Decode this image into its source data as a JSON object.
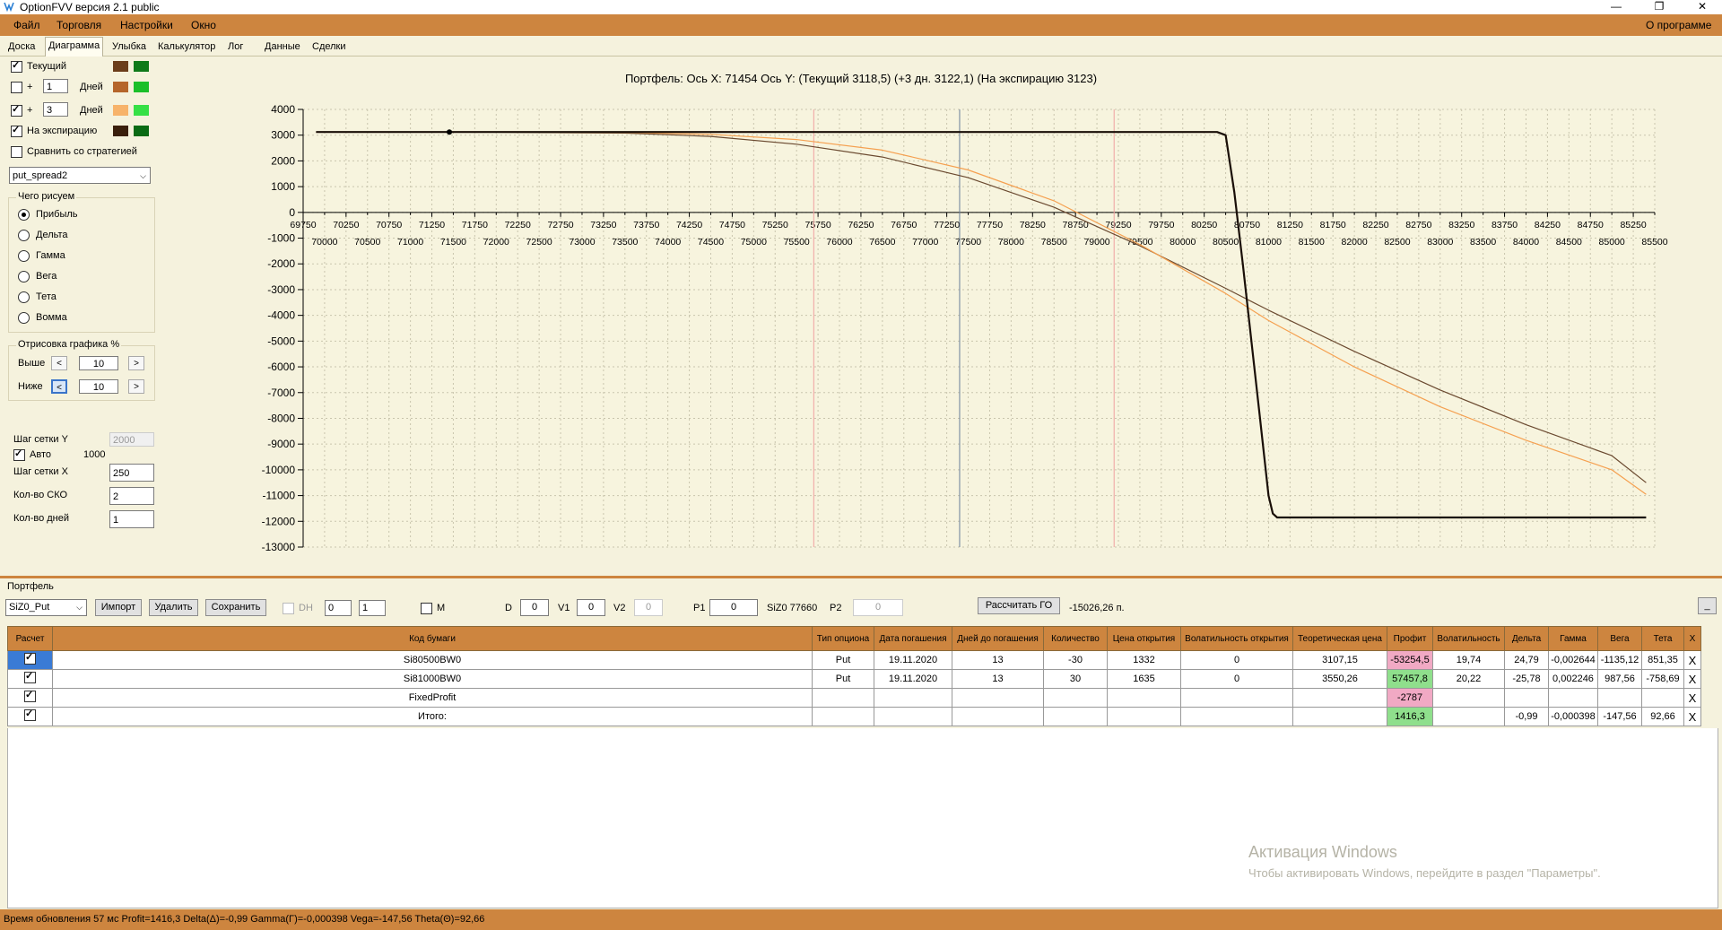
{
  "window": {
    "title": "OptionFVV версия 2.1 public",
    "min": "—",
    "max": "❐",
    "close": "✕"
  },
  "menu": {
    "items": [
      "Файл",
      "Торговля",
      "Настройки",
      "Окно"
    ],
    "about": "О программе"
  },
  "tabs": [
    "Доска",
    "Диаграмма",
    "Улыбка",
    "Калькулятор",
    "Лог",
    "Данные",
    "Сделки"
  ],
  "left": {
    "current": "Текущий",
    "plus": "+",
    "days": "Дней",
    "days1_value": "1",
    "days2_value": "3",
    "expiry": "На экспирацию",
    "compare": "Сравнить со стратегией",
    "strategy": "put_spread2",
    "what_title": "Чего рисуем",
    "radios": [
      "Прибыль",
      "Дельта",
      "Гамма",
      "Вега",
      "Тета",
      "Вомма"
    ],
    "draw_title": "Отрисовка графика %",
    "above": "Выше",
    "below": "Ниже",
    "above_value": "10",
    "below_value": "10",
    "left_arrow": "<",
    "right_arrow": ">",
    "grid_y": "Шаг сетки Y",
    "grid_y_value": "2000",
    "auto": "Авто",
    "auto_value": "1000",
    "grid_x": "Шаг сетки X",
    "grid_x_value": "250",
    "sko": "Кол-во СКО",
    "sko_value": "2",
    "ndays": "Кол-во дней",
    "ndays_value": "1",
    "colors": {
      "cur_dark": "#6b3d1a",
      "cur_green": "#0f7a1a",
      "d1_brown": "#b5652a",
      "d1_green": "#1bbf2a",
      "d3_orange": "#f7b36a",
      "d3_green": "#36e046",
      "exp_dark": "#3a1f0c",
      "exp_green": "#0a6b14"
    }
  },
  "chart_header": "Портфель: Ось X: 71454 Ось Y:  (Текущий 3118,5)  (+3 дн. 3122,1)  (На экспирацию 3123)",
  "chart_data": {
    "type": "line",
    "xlim": [
      69750,
      85500
    ],
    "ylim": [
      -13000,
      4000
    ],
    "y_ticks": [
      4000,
      3000,
      2000,
      1000,
      0,
      -1000,
      -2000,
      -3000,
      -4000,
      -5000,
      -6000,
      -7000,
      -8000,
      -9000,
      -10000,
      -11000,
      -12000,
      -13000
    ],
    "x_ticks_upper": [
      69750,
      70250,
      70750,
      71250,
      71750,
      72250,
      72750,
      73250,
      73750,
      74250,
      74750,
      75250,
      75750,
      76250,
      76750,
      77250,
      77750,
      78250,
      78750,
      79250,
      79750,
      80250,
      80750,
      81250,
      81750,
      82250,
      82750,
      83250,
      83750,
      84250,
      84750,
      85250
    ],
    "x_ticks_lower": [
      70000,
      70500,
      71000,
      71500,
      72000,
      72500,
      73000,
      73500,
      74000,
      74500,
      75000,
      75500,
      76000,
      76500,
      77000,
      77500,
      78000,
      78500,
      79000,
      79500,
      80000,
      80500,
      81000,
      81500,
      82000,
      82500,
      83000,
      83500,
      84000,
      84500,
      85000,
      85500
    ],
    "vlines": [
      {
        "x": 75700,
        "color": "#f0a0a0"
      },
      {
        "x": 77400,
        "color": "#6a7f9a"
      },
      {
        "x": 79200,
        "color": "#f0a0a0"
      }
    ],
    "marker": {
      "x": 71454,
      "y": 3118.5
    },
    "series": [
      {
        "color": "#6b4a30",
        "x": [
          69900,
          72000,
          73500,
          74500,
          75500,
          76500,
          77500,
          78500,
          79500,
          80500,
          81000,
          82000,
          83000,
          84000,
          85000,
          85400
        ],
        "y": [
          3118,
          3115,
          3080,
          2950,
          2650,
          2150,
          1350,
          200,
          -1300,
          -2950,
          -3800,
          -5400,
          -6900,
          -8250,
          -9450,
          -10500
        ]
      },
      {
        "color": "#f5a050",
        "x": [
          69900,
          72000,
          73500,
          74500,
          75500,
          76500,
          77500,
          78500,
          79500,
          80500,
          81000,
          82000,
          83000,
          84000,
          85000,
          85400
        ],
        "y": [
          3122,
          3121,
          3105,
          3030,
          2830,
          2420,
          1650,
          450,
          -1250,
          -3150,
          -4200,
          -6000,
          -7550,
          -8850,
          -10000,
          -10950
        ]
      },
      {
        "color": "#1a0f08",
        "x": [
          69900,
          80400,
          80500,
          80600,
          80700,
          80800,
          80900,
          81000,
          81050,
          81100,
          85400
        ],
        "y": [
          3123,
          3123,
          3000,
          800,
          -2000,
          -5000,
          -8000,
          -11000,
          -11700,
          -11850,
          -11850
        ]
      }
    ]
  },
  "portfolio": {
    "title": "Портфель",
    "code": "SiZ0_Put",
    "import": "Импорт",
    "delete": "Удалить",
    "save": "Сохранить",
    "dh": "DH",
    "dh_val1": "0",
    "dh_val2": "1",
    "m": "M",
    "d": "D",
    "d_val": "0",
    "v1": "V1",
    "v1_val": "0",
    "v2": "V2",
    "v2_val": "0",
    "p1": "P1",
    "p1_val": "0",
    "siz": "SiZ0 77660",
    "p2": "P2",
    "p2_val": "0",
    "calc_go": "Рассчитать ГО",
    "go_value": "-15026,26 п.",
    "minimize": "_"
  },
  "table": {
    "headers": [
      "Расчет",
      "Код бумаги",
      "Тип опциона",
      "Дата погашения",
      "Дней до погашения",
      "Количество",
      "Цена открытия",
      "Волатильность открытия",
      "Теоретическая цена",
      "Профит",
      "Волатильность",
      "Дельта",
      "Гамма",
      "Вега",
      "Тета",
      "X"
    ],
    "rows": [
      {
        "code": "Si80500BW0",
        "type": "Put",
        "date": "19.11.2020",
        "days": "13",
        "qty": "-30",
        "price": "1332",
        "vol_open": "0",
        "theo": "3107,15",
        "profit": "-53254,5",
        "vol": "19,74",
        "delta": "24,79",
        "gamma": "-0,002644",
        "vega": "-1135,12",
        "theta": "851,35",
        "x": "X"
      },
      {
        "code": "Si81000BW0",
        "type": "Put",
        "date": "19.11.2020",
        "days": "13",
        "qty": "30",
        "price": "1635",
        "vol_open": "0",
        "theo": "3550,26",
        "profit": "57457,8",
        "vol": "20,22",
        "delta": "-25,78",
        "gamma": "0,002246",
        "vega": "987,56",
        "theta": "-758,69",
        "x": "X"
      },
      {
        "code": "FixedProfit",
        "type": "",
        "date": "",
        "days": "",
        "qty": "",
        "price": "",
        "vol_open": "",
        "theo": "",
        "profit": "-2787",
        "vol": "",
        "delta": "",
        "gamma": "",
        "vega": "",
        "theta": "",
        "x": "X"
      },
      {
        "code": "Итого:",
        "type": "",
        "date": "",
        "days": "",
        "qty": "",
        "price": "",
        "vol_open": "",
        "theo": "",
        "profit": "1416,3",
        "vol": "",
        "delta": "-0,99",
        "gamma": "-0,000398",
        "vega": "-147,56",
        "theta": "92,66",
        "x": "X"
      }
    ]
  },
  "watermark": {
    "line1": "Активация Windows",
    "line2": "Чтобы активировать Windows, перейдите в раздел \"Параметры\"."
  },
  "status": "Время обновления 57 мс  Profit=1416,3 Delta(Δ)=-0,99 Gamma(Γ)=-0,000398 Vega=-147,56 Theta(Θ)=92,66"
}
